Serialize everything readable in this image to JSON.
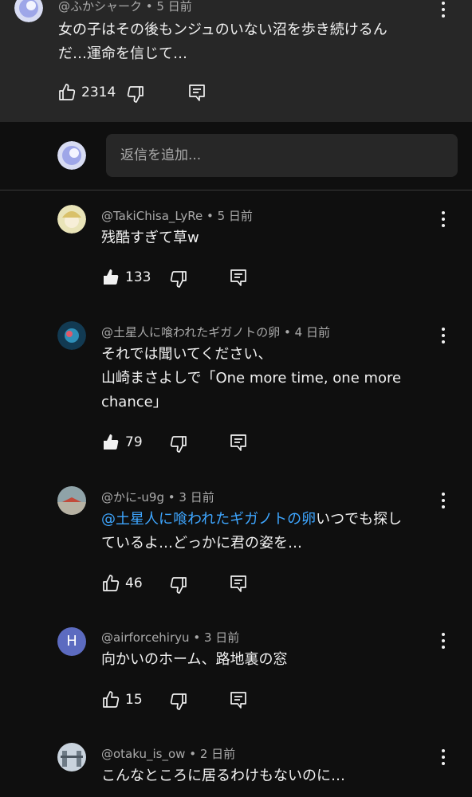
{
  "parent_comment": {
    "author": "@ふかシャーク",
    "time": "5 日前",
    "text_line1": "女の子はその後もンジュのいない沼を歩き続けるん",
    "text_line2": "だ…運命を信じて…",
    "likes": "2314"
  },
  "reply_input": {
    "placeholder": "返信を追加..."
  },
  "replies": [
    {
      "author": "@TakiChisa_LyRe",
      "time": "5 日前",
      "lines": [
        "残酷すぎて草w"
      ],
      "likes": "133",
      "liked": true
    },
    {
      "author": "@土星人に喰われたギガノトの卵",
      "time": "4 日前",
      "lines": [
        "それでは聞いてください、",
        "山崎まさよしで「One more time, one more",
        "chance」"
      ],
      "likes": "79",
      "liked": true
    },
    {
      "author": "@かに-u9g",
      "time": "3 日前",
      "mention": "@土星人に喰われたギガノトの卵",
      "line1_rest": "いつでも探し",
      "line2": "ているよ…どっかに君の姿を…",
      "likes": "46",
      "liked": false
    },
    {
      "author": "@airforcehiryu",
      "time": "3 日前",
      "avatar_letter": "H",
      "lines": [
        "向かいのホーム、路地裏の窓"
      ],
      "likes": "15",
      "liked": false
    },
    {
      "author": "@otaku_is_ow",
      "time": "2 日前",
      "lines": [
        "こんなところに居るわけもないのに…"
      ]
    }
  ],
  "icons": {
    "like": "thumbs-up-icon",
    "dislike": "thumbs-down-icon",
    "reply": "reply-comment-icon",
    "menu": "more-vert-icon"
  },
  "colors": {
    "mention": "#3ea6ff",
    "background": "#0f0f0f",
    "top_panel": "#272727"
  }
}
